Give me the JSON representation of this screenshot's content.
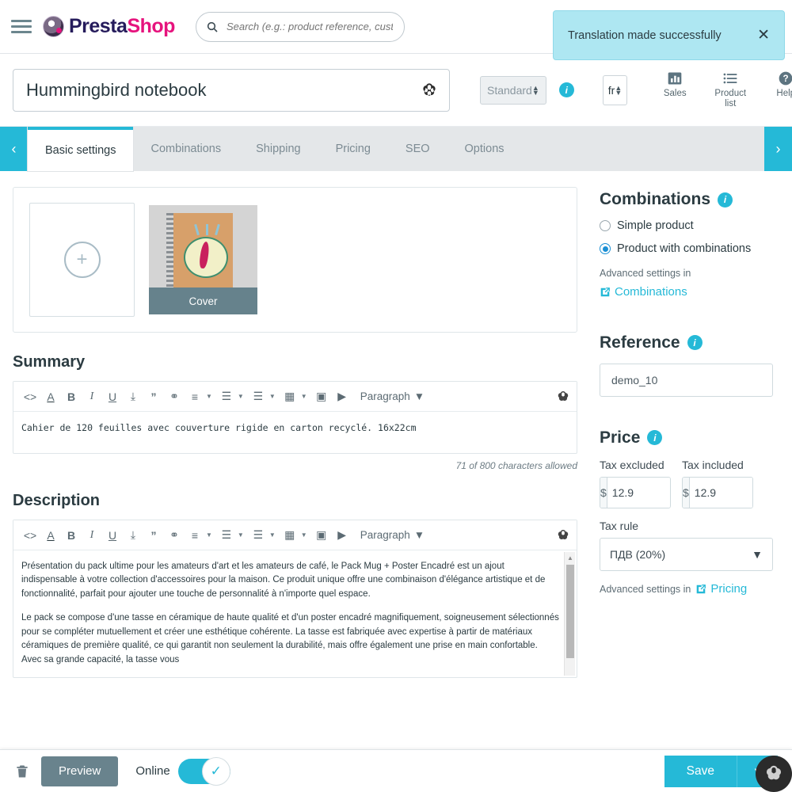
{
  "header": {
    "menu_icon": "hamburger-icon",
    "brand_first": "Presta",
    "brand_second": "Shop",
    "search_placeholder": "Search (e.g.: product reference, custom",
    "search_value": "",
    "search_icon": "search-icon"
  },
  "toast": {
    "message": "Translation made successfully",
    "close_label": "✕"
  },
  "product": {
    "name": "Hummingbird notebook",
    "ai_icon": "ai-assistant-icon",
    "type_select": "Standard",
    "language_select": "fr"
  },
  "header_actions": [
    {
      "label_line1": "Sales",
      "label_line2": "",
      "icon": "bar-chart-icon"
    },
    {
      "label_line1": "Product",
      "label_line2": "list",
      "icon": "list-icon"
    },
    {
      "label_line1": "Help",
      "label_line2": "",
      "icon": "help-circle-icon"
    }
  ],
  "tabs": {
    "prev_icon": "‹",
    "next_icon": "›",
    "items": [
      {
        "label": "Basic settings",
        "active": true
      },
      {
        "label": "Combinations",
        "active": false
      },
      {
        "label": "Shipping",
        "active": false
      },
      {
        "label": "Pricing",
        "active": false
      },
      {
        "label": "SEO",
        "active": false
      },
      {
        "label": "Options",
        "active": false
      }
    ]
  },
  "images": {
    "add_label": "+",
    "cover_label": "Cover"
  },
  "summary": {
    "heading": "Summary",
    "text": "Cahier de 120 feuilles avec couverture rigide en carton recyclé. 16x22cm",
    "char_count": "71 of 800 characters allowed"
  },
  "description": {
    "heading": "Description",
    "paragraph1": "Présentation du pack ultime pour les amateurs d'art et les amateurs de café, le Pack Mug + Poster Encadré est un ajout indispensable à votre collection d'accessoires pour la maison. Ce produit unique offre une combinaison d'élégance artistique et de fonctionnalité, parfait pour ajouter une touche de personnalité à n'importe quel espace.",
    "paragraph2": "Le pack se compose d'une tasse en céramique de haute qualité et d'un poster encadré magnifiquement, soigneusement sélectionnés pour se compléter mutuellement et créer une esthétique cohérente. La tasse est fabriquée avec expertise à partir de matériaux céramiques de première qualité, ce qui garantit non seulement la durabilité, mais offre également une prise en main confortable. Avec sa grande capacité, la tasse vous"
  },
  "editor_toolbar": {
    "paragraph_label": "Paragraph",
    "buttons": [
      {
        "name": "source-code-icon",
        "glyph": "<>"
      },
      {
        "name": "text-color-icon",
        "glyph": "A"
      },
      {
        "name": "bold-icon",
        "glyph": "B"
      },
      {
        "name": "italic-icon",
        "glyph": "I"
      },
      {
        "name": "underline-icon",
        "glyph": "U"
      },
      {
        "name": "strikethrough-icon",
        "glyph": "⤓"
      },
      {
        "name": "blockquote-icon",
        "glyph": "”"
      },
      {
        "name": "link-icon",
        "glyph": "⚭"
      },
      {
        "name": "align-icon",
        "glyph": "≡"
      },
      {
        "name": "bullet-list-icon",
        "glyph": "☰"
      },
      {
        "name": "numbered-list-icon",
        "glyph": "☰"
      },
      {
        "name": "table-icon",
        "glyph": "▦"
      },
      {
        "name": "image-icon",
        "glyph": "▣"
      },
      {
        "name": "video-icon",
        "glyph": "▶"
      }
    ]
  },
  "combinations": {
    "heading": "Combinations",
    "option_simple": "Simple product",
    "option_combinations": "Product with combinations",
    "selected": "combinations",
    "advanced_note": "Advanced settings in",
    "link_label": "Combinations"
  },
  "reference": {
    "heading": "Reference",
    "value": "demo_10"
  },
  "price": {
    "heading": "Price",
    "tax_excluded_label": "Tax excluded",
    "tax_excluded_value": "12.9",
    "tax_included_label": "Tax included",
    "tax_included_value": "12.9",
    "currency": "$",
    "tax_rule_label": "Tax rule",
    "tax_rule_value": "ПДВ (20%)",
    "advanced_note": "Advanced settings in",
    "link_label": "Pricing"
  },
  "footer": {
    "delete_icon": "trash-icon",
    "preview_label": "Preview",
    "online_label": "Online",
    "online_state": true,
    "save_label": "Save",
    "save_caret": "⌄"
  },
  "colors": {
    "accent": "#25b9d7",
    "brand_pink": "#e6137d",
    "brand_navy": "#251b5b",
    "toast_bg": "#aee7f2",
    "preview_gray": "#69838d"
  }
}
